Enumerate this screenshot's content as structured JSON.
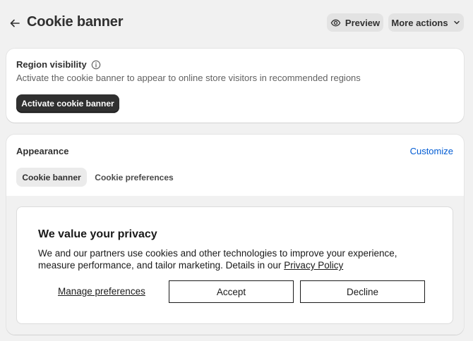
{
  "header": {
    "title": "Cookie banner",
    "back_icon": "arrow-left-icon",
    "preview_label": "Preview",
    "preview_icon": "eye-icon",
    "more_actions_label": "More actions",
    "more_actions_icon": "chevron-down-icon"
  },
  "region": {
    "title": "Region visibility",
    "info_icon": "info-icon",
    "description": "Activate the cookie banner to appear to online store visitors in recommended regions",
    "activate_label": "Activate cookie banner"
  },
  "appearance": {
    "title": "Appearance",
    "customize_label": "Customize",
    "tabs": [
      {
        "label": "Cookie banner",
        "active": true
      },
      {
        "label": "Cookie preferences",
        "active": false
      }
    ]
  },
  "banner": {
    "title": "We value your privacy",
    "text": "We and our partners use cookies and other technologies to improve your experience, measure performance, and tailor marketing. Details in our",
    "policy_link": "Privacy Policy",
    "manage_label": "Manage preferences",
    "accept_label": "Accept",
    "decline_label": "Decline"
  },
  "colors": {
    "background": "#f1f1f1",
    "card": "#ffffff",
    "primary_button": "#303030",
    "link": "#005bd3"
  }
}
